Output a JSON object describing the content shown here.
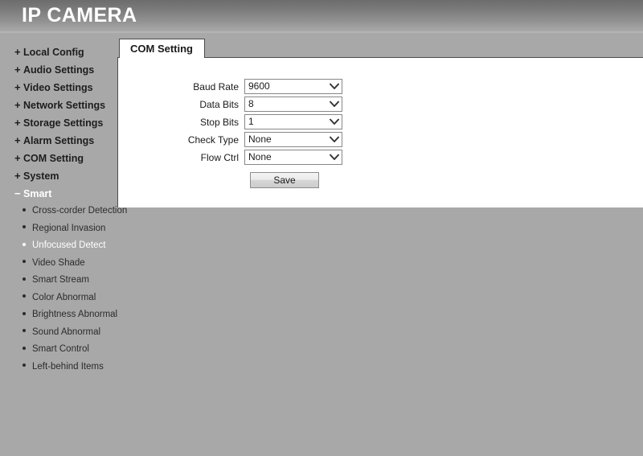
{
  "header": {
    "title": "IP CAMERA"
  },
  "sidebar": {
    "groups": [
      {
        "toggle": "+",
        "label": "Local Config",
        "expanded": false
      },
      {
        "toggle": "+",
        "label": "Audio Settings",
        "expanded": false
      },
      {
        "toggle": "+",
        "label": "Video Settings",
        "expanded": false
      },
      {
        "toggle": "+",
        "label": "Network Settings",
        "expanded": false
      },
      {
        "toggle": "+",
        "label": "Storage Settings",
        "expanded": false
      },
      {
        "toggle": "+",
        "label": "Alarm Settings",
        "expanded": false
      },
      {
        "toggle": "+",
        "label": "COM Setting",
        "expanded": false
      },
      {
        "toggle": "+",
        "label": "System",
        "expanded": false
      },
      {
        "toggle": "−",
        "label": "Smart",
        "expanded": true
      }
    ],
    "smart_items": [
      {
        "label": "Cross-corder Detection",
        "active": false
      },
      {
        "label": "Regional Invasion",
        "active": false
      },
      {
        "label": "Unfocused Detect",
        "active": true
      },
      {
        "label": "Video Shade",
        "active": false
      },
      {
        "label": "Smart Stream",
        "active": false
      },
      {
        "label": "Color Abnormal",
        "active": false
      },
      {
        "label": "Brightness Abnormal",
        "active": false
      },
      {
        "label": "Sound Abnormal",
        "active": false
      },
      {
        "label": "Smart Control",
        "active": false
      },
      {
        "label": "Left-behind Items",
        "active": false
      }
    ]
  },
  "content": {
    "tabs": [
      {
        "label": "COM Setting",
        "active": true
      }
    ],
    "form": {
      "fields": [
        {
          "label": "Baud Rate",
          "value": "9600"
        },
        {
          "label": "Data Bits",
          "value": "8"
        },
        {
          "label": "Stop Bits",
          "value": "1"
        },
        {
          "label": "Check Type",
          "value": "None"
        },
        {
          "label": "Flow Ctrl",
          "value": "None"
        }
      ],
      "save_label": "Save"
    }
  },
  "colors": {
    "page_bg": "#a8a8a8",
    "header_top": "#6c6c6c",
    "header_bottom": "#a9a9a9",
    "panel_bg": "#ffffff",
    "active_nav": "#ffffff"
  }
}
